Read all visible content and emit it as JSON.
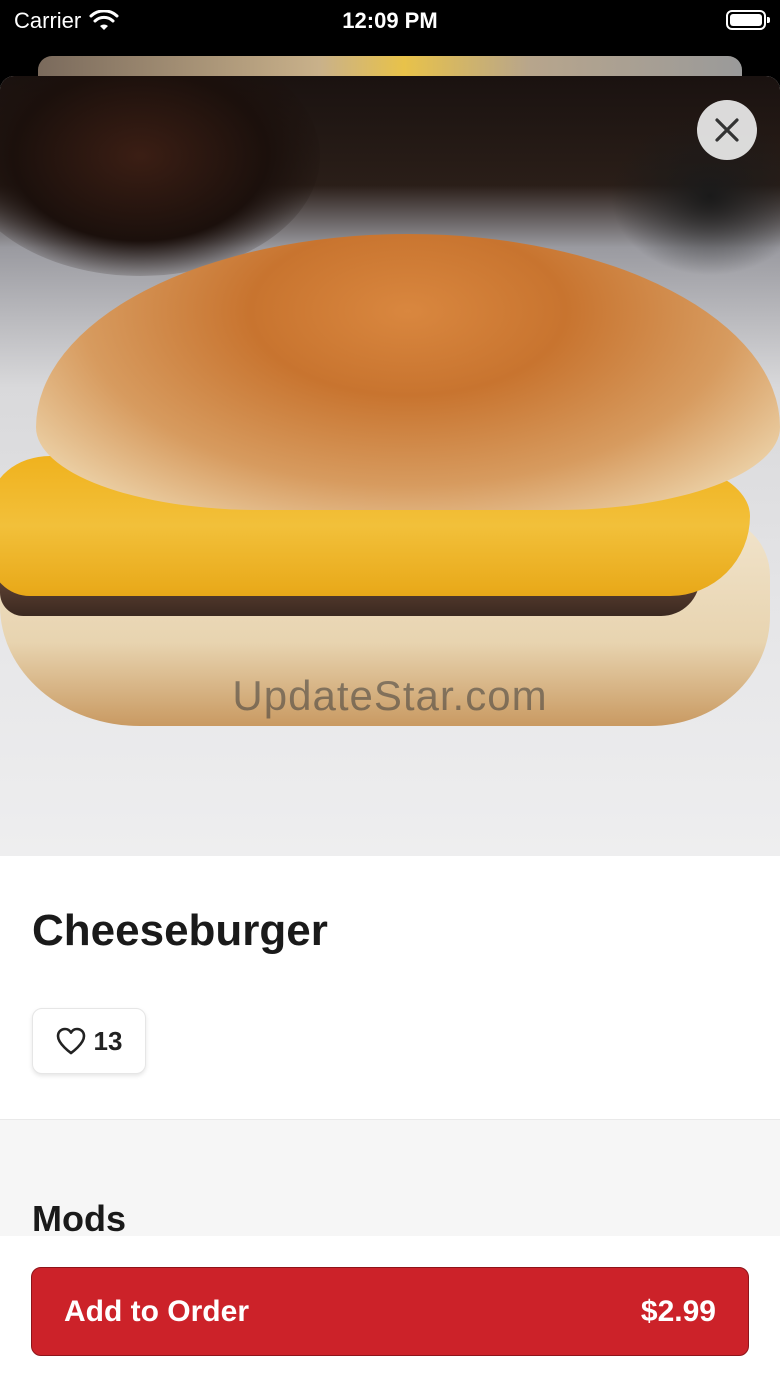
{
  "status_bar": {
    "carrier": "Carrier",
    "time": "12:09 PM"
  },
  "item": {
    "name": "Cheeseburger",
    "likes": "13"
  },
  "watermark": "UpdateStar.com",
  "mods": {
    "title": "Mods"
  },
  "footer": {
    "add_label": "Add to Order",
    "price": "$2.99"
  },
  "icons": {
    "close": "close-icon",
    "heart": "heart-icon",
    "wifi": "wifi-icon",
    "battery": "battery-icon"
  },
  "colors": {
    "accent": "#cc2229",
    "surface": "#ffffff",
    "section_bg": "#f6f6f6"
  }
}
